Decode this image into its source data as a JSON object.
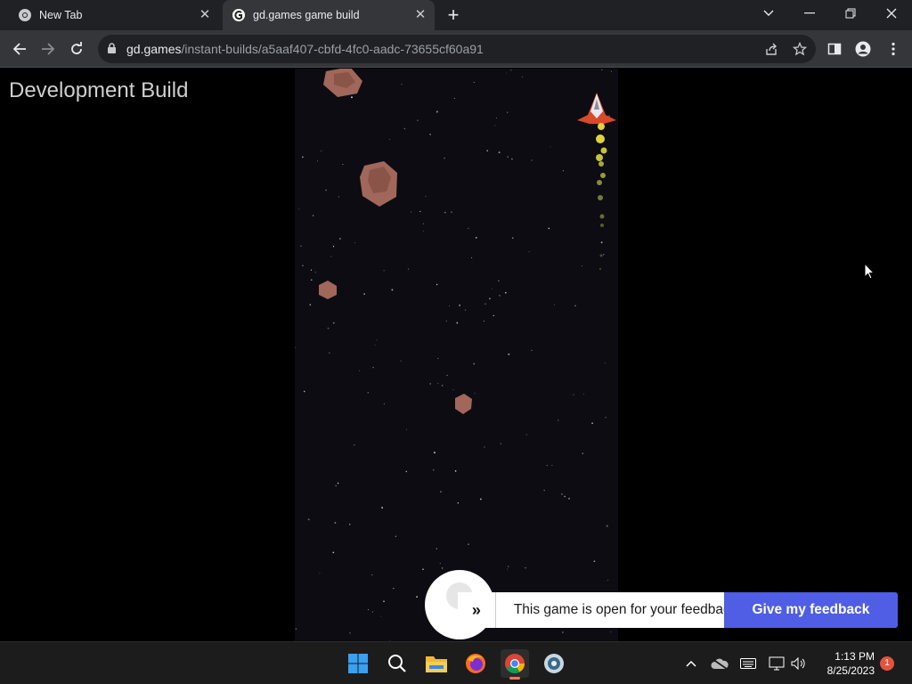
{
  "browser": {
    "tabs": [
      {
        "title": "New Tab",
        "icon": "chrome-icon"
      },
      {
        "title": "gd.games game build",
        "icon": "gdevelop-icon",
        "active": true
      }
    ],
    "url_host": "gd.games",
    "url_path": "/instant-builds/a5aaf407-cbfd-4fc0-aadc-73655cf60a91"
  },
  "page": {
    "overlay_text": "Development Build",
    "feedback_message": "This game is open for your feedback",
    "feedback_button": "Give my feedback"
  },
  "game": {
    "background_color": "#0d0c12",
    "asteroid_color": "#a0675a",
    "ship_colors": [
      "#e8e8ee",
      "#d84a2a",
      "#e0d23a"
    ]
  },
  "taskbar": {
    "apps": [
      "start-icon",
      "search-icon",
      "file-explorer-icon",
      "firefox-icon",
      "chrome-icon",
      "gdevelop-app-icon"
    ],
    "time": "1:13 PM",
    "date": "8/25/2023",
    "notification_count": "1"
  }
}
